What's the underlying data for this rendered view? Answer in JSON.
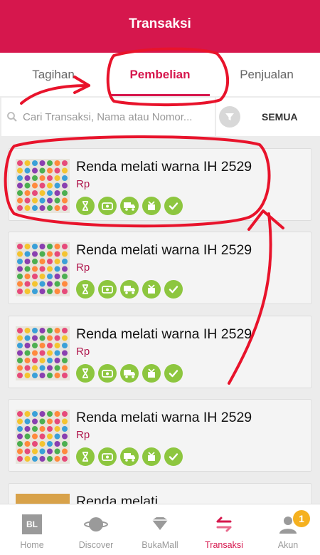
{
  "header": {
    "title": "Transaksi"
  },
  "tabs": [
    {
      "label": "Tagihan",
      "active": false
    },
    {
      "label": "Pembelian",
      "active": true
    },
    {
      "label": "Penjualan",
      "active": false
    }
  ],
  "search": {
    "placeholder": "Cari Transaksi, Nama atau Nomor...",
    "value": ""
  },
  "filter": {
    "label": "SEMUA",
    "icon": "funnel-icon"
  },
  "transactions": [
    {
      "name": "Renda melati warna IH 2529",
      "price": "Rp"
    },
    {
      "name": "Renda melati warna IH 2529",
      "price": "Rp"
    },
    {
      "name": "Renda melati warna IH 2529",
      "price": "Rp"
    },
    {
      "name": "Renda melati warna IH 2529",
      "price": "Rp"
    },
    {
      "name": "Renda melati",
      "price": ""
    }
  ],
  "status_steps": [
    "hourglass-icon",
    "cash-icon",
    "truck-icon",
    "package-icon",
    "check-icon"
  ],
  "nav": {
    "items": [
      {
        "label": "Home",
        "icon": "bl-logo-icon"
      },
      {
        "label": "Discover",
        "icon": "planet-icon"
      },
      {
        "label": "BukaMall",
        "icon": "diamond-icon"
      },
      {
        "label": "Transaksi",
        "icon": "transfer-arrows-icon",
        "active": true
      },
      {
        "label": "Akun",
        "icon": "user-icon",
        "badge": "1"
      }
    ]
  },
  "colors": {
    "brand": "#d6174d",
    "step_done": "#8dc63f",
    "badge": "#f5b120",
    "annotation": "#e8132b"
  }
}
